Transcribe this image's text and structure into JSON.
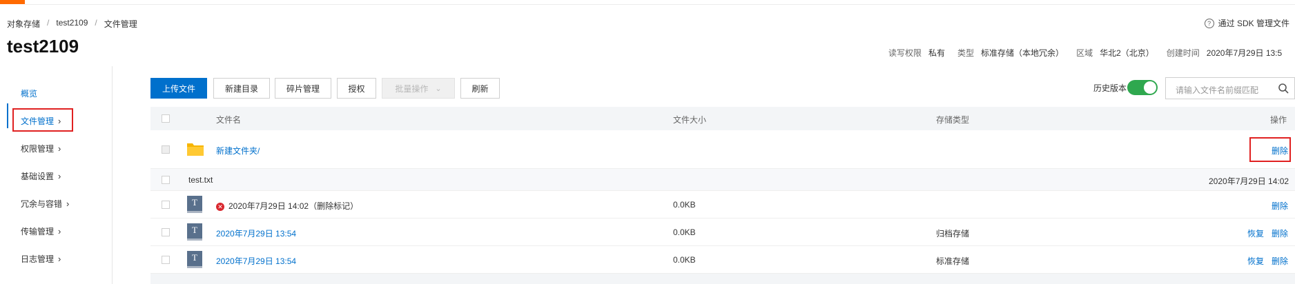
{
  "breadcrumb": [
    "对象存储",
    "test2109",
    "文件管理"
  ],
  "help_link": "通过 SDK 管理文件",
  "bucket": {
    "name": "test2109",
    "meta": [
      {
        "label": "读写权限",
        "value": "私有"
      },
      {
        "label": "类型",
        "value": "标准存储（本地冗余）"
      },
      {
        "label": "区域",
        "value": "华北2（北京）"
      },
      {
        "label": "创建时间",
        "value": "2020年7月29日 13:5"
      }
    ]
  },
  "sidebar": {
    "items": [
      {
        "label": "概览",
        "chevron": false
      },
      {
        "label": "文件管理",
        "chevron": true,
        "active": true
      },
      {
        "label": "权限管理",
        "chevron": true
      },
      {
        "label": "基础设置",
        "chevron": true
      },
      {
        "label": "冗余与容错",
        "chevron": true
      },
      {
        "label": "传输管理",
        "chevron": true
      },
      {
        "label": "日志管理",
        "chevron": true
      }
    ]
  },
  "toolbar": {
    "upload": "上传文件",
    "new_dir": "新建目录",
    "fragments": "碎片管理",
    "authorize": "授权",
    "batch": "批量操作",
    "refresh": "刷新",
    "history_label": "历史版本",
    "history_on": true,
    "search_placeholder": "请输入文件名前缀匹配"
  },
  "table": {
    "headers": {
      "name": "文件名",
      "size": "文件大小",
      "storage": "存储类型",
      "actions": "操作"
    },
    "folder_row": {
      "name": "新建文件夹/",
      "action": "删除"
    },
    "group_row": {
      "name": "test.txt",
      "time": "2020年7月29日 14:02"
    },
    "version_rows": [
      {
        "name": "2020年7月29日 14:02（删除标记）",
        "deleted": true,
        "size": "0.0KB",
        "storage": "",
        "actions": [
          "删除"
        ]
      },
      {
        "name": "2020年7月29日 13:54",
        "deleted": false,
        "size": "0.0KB",
        "storage": "归档存储",
        "actions": [
          "恢复",
          "删除"
        ]
      },
      {
        "name": "2020年7月29日 13:54",
        "deleted": false,
        "size": "0.0KB",
        "storage": "标准存储",
        "actions": [
          "恢复",
          "删除"
        ]
      }
    ]
  },
  "colors": {
    "accent": "#0070cc",
    "brand": "#ff6a00",
    "toggle_on": "#2fa84f",
    "highlight": "#e02020",
    "error": "#d9272e"
  }
}
